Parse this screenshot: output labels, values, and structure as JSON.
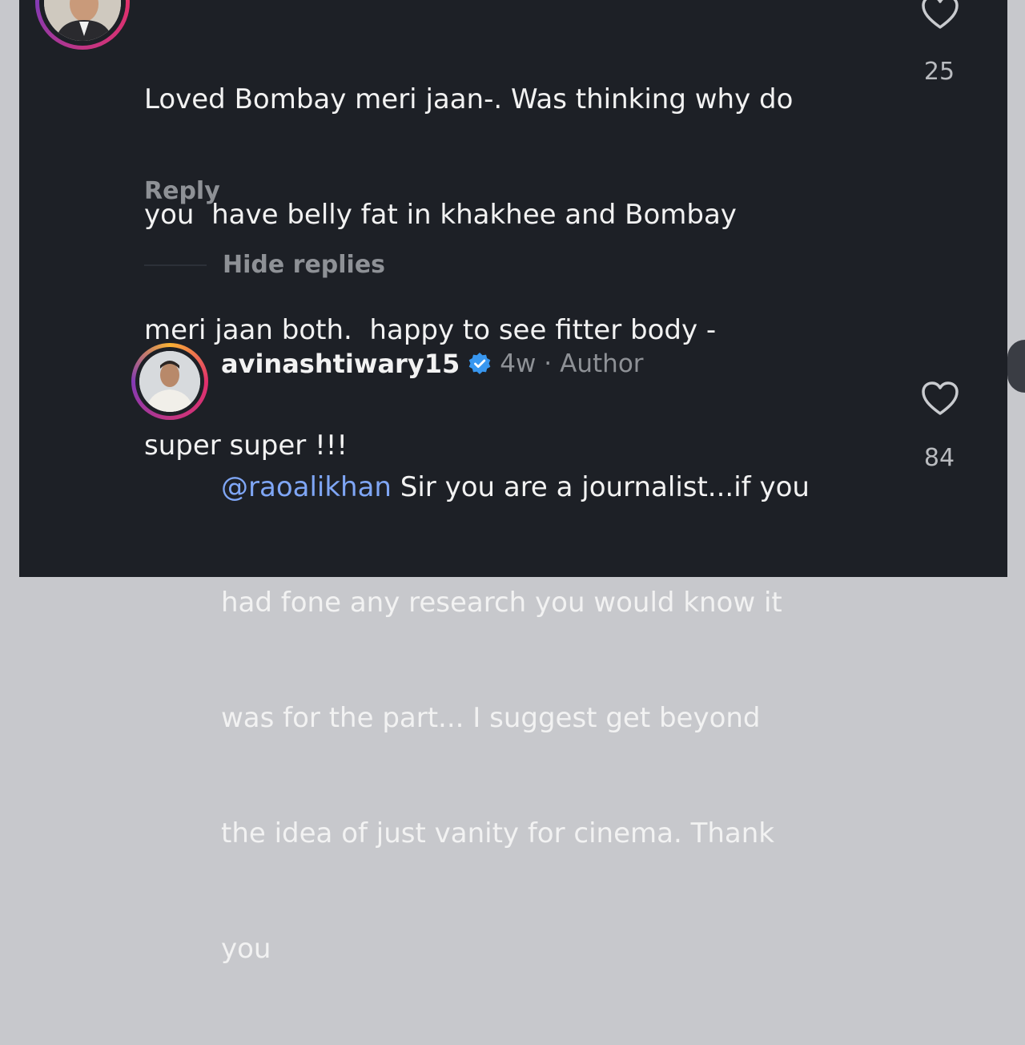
{
  "comment": {
    "text_lines": [
      "Loved Bombay meri jaan-. Was thinking why do",
      "you  have belly fat in khakhee and Bombay",
      "meri jaan both.  happy to see fitter body -",
      "super super !!!"
    ],
    "like_count": "25",
    "reply_label": "Reply"
  },
  "hide_replies_label": "Hide replies",
  "reply": {
    "username": "avinashtiwary15",
    "time": "4w",
    "separator": "·",
    "author_label": "Author",
    "mention": "@raoalikhan",
    "text_first_line_rest": " Sir you are a journalist...if you",
    "text_lines": [
      "had fone any research you would know it",
      "was for the part... I suggest get beyond",
      "the idea of just vanity for cinema. Thank",
      "you"
    ],
    "like_count": "84"
  },
  "icons": {
    "like": "heart-outline-icon",
    "verified": "verified-badge-icon"
  },
  "colors": {
    "background": "#1d2026",
    "text": "#f2f2f2",
    "muted": "#8e9196",
    "mention": "#7fa6f5",
    "verified": "#3897f0"
  }
}
